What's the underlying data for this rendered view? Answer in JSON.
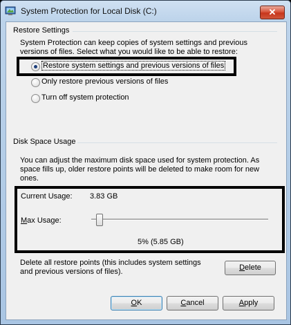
{
  "window": {
    "title": "System Protection for Local Disk (C:)",
    "close_glyph": "✕"
  },
  "restore_settings": {
    "group_title": "Restore Settings",
    "description_line1": "System Protection can keep copies of system settings and previous",
    "description_line2": "versions of files. Select what you would like to be able to restore:",
    "options": [
      {
        "label": "Restore system settings and previous versions of files",
        "checked": true
      },
      {
        "label": "Only restore previous versions of files",
        "checked": false
      },
      {
        "label": "Turn off system protection",
        "checked": false
      }
    ]
  },
  "disk_space": {
    "group_title": "Disk Space Usage",
    "description_line1": "You can adjust the maximum disk space used for system protection. As",
    "description_line2": "space fills up, older restore points will be deleted to make room for new",
    "description_line3": "ones.",
    "current_usage_label": "Current Usage:",
    "current_usage_value": "3.83 GB",
    "max_usage_label_prefix": "M",
    "max_usage_label_rest": "ax Usage:",
    "slider_percent": 5,
    "slider_readout": "5% (5.85 GB)"
  },
  "delete_section": {
    "text_line1": "Delete all restore points (this includes system settings",
    "text_line2": "and previous versions of files).",
    "delete_button_accel": "D",
    "delete_button_rest": "elete"
  },
  "footer": {
    "ok_accel": "O",
    "ok_rest": "K",
    "cancel_accel": "C",
    "cancel_rest": "ancel",
    "apply_accel": "A",
    "apply_rest": "pply"
  },
  "colors": {
    "title_bar": "#bcd3ea",
    "client_bg": "#f0f0f0",
    "close_button": "#c7361c",
    "highlight_outline": "#000000"
  }
}
